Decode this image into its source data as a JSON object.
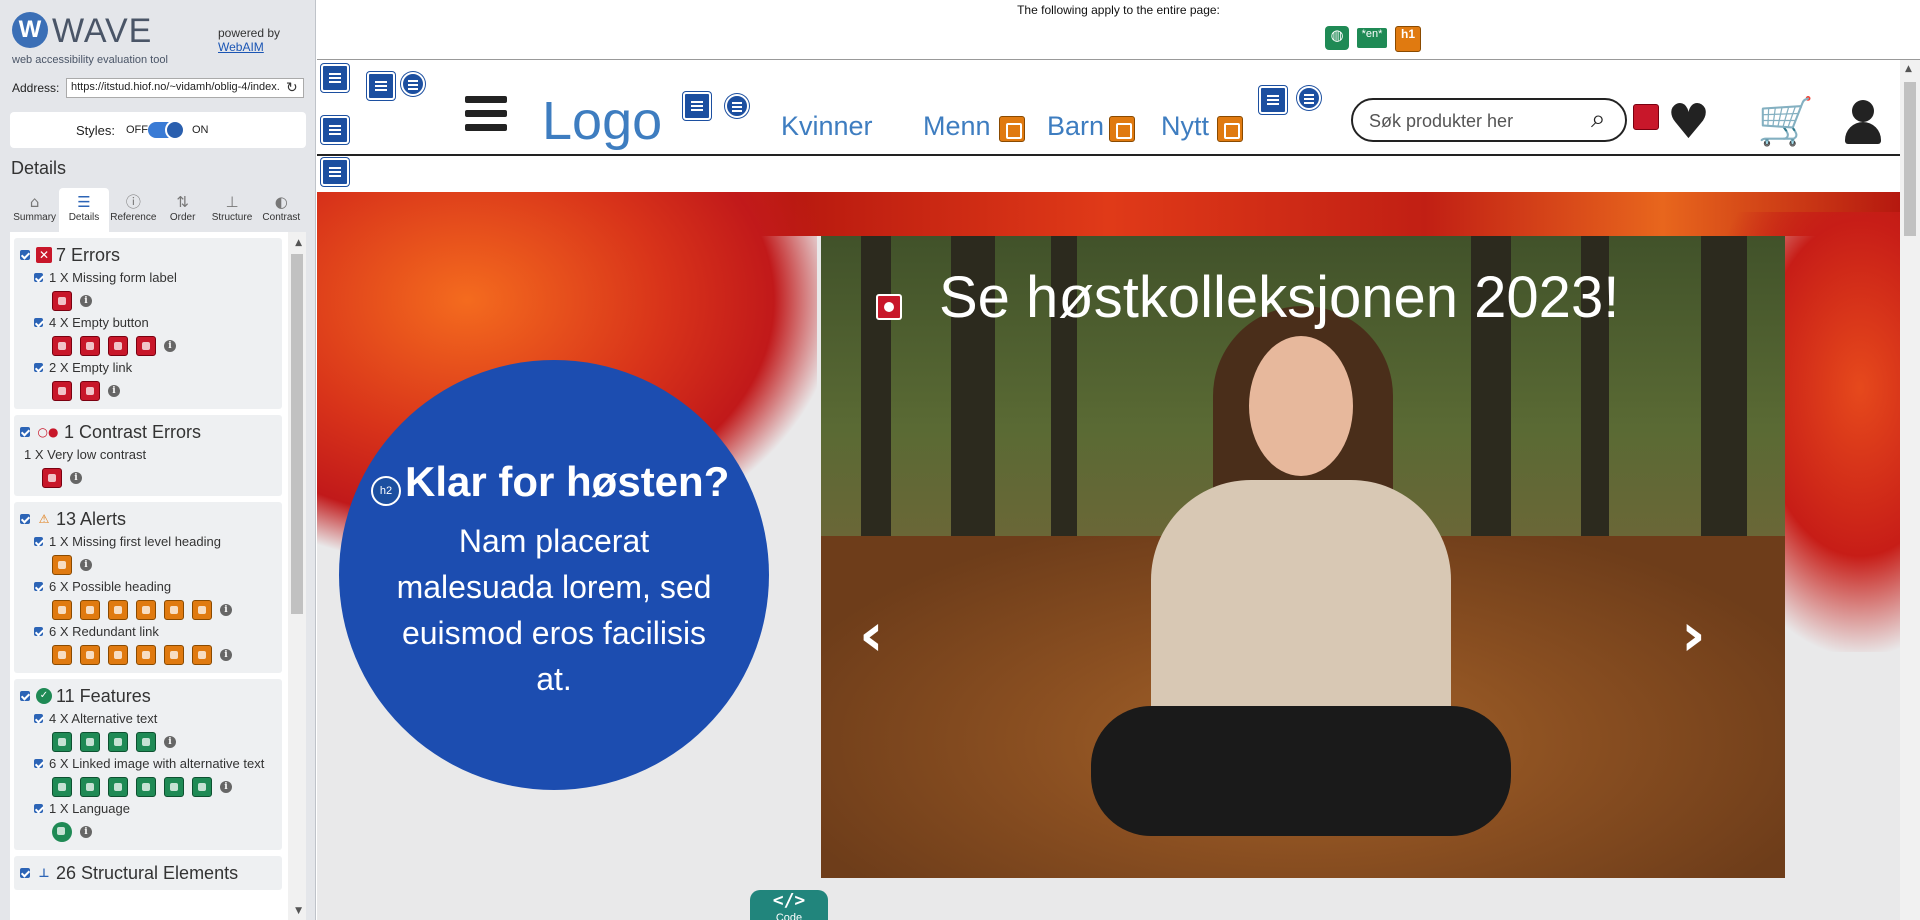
{
  "wave": {
    "brand": "WAVE",
    "tagline": "web accessibility evaluation tool",
    "powered_by": "powered by",
    "webaim_link": "WebAIM",
    "address_label": "Address:",
    "address_value": "https://itstud.hiof.no/~vidamh/oblig-4/index.",
    "styles_label": "Styles:",
    "styles_off": "OFF",
    "styles_on": "ON",
    "details_heading": "Details",
    "tabs": [
      {
        "label": "Summary",
        "icon": "home-icon"
      },
      {
        "label": "Details",
        "icon": "list-icon"
      },
      {
        "label": "Reference",
        "icon": "info-icon"
      },
      {
        "label": "Order",
        "icon": "order-icon"
      },
      {
        "label": "Structure",
        "icon": "structure-icon"
      },
      {
        "label": "Contrast",
        "icon": "contrast-icon"
      }
    ],
    "active_tab": "Details",
    "categories": {
      "errors": {
        "title": "7 Errors",
        "items": [
          {
            "label": "1 X Missing form label",
            "count": 1
          },
          {
            "label": "4 X Empty button",
            "count": 4
          },
          {
            "label": "2 X Empty link",
            "count": 2
          }
        ]
      },
      "contrast": {
        "title": "1 Contrast Errors",
        "items": [
          {
            "label": "1 X Very low contrast",
            "count": 1
          }
        ]
      },
      "alerts": {
        "title": "13 Alerts",
        "items": [
          {
            "label": "1 X Missing first level heading",
            "count": 1
          },
          {
            "label": "6 X Possible heading",
            "count": 6
          },
          {
            "label": "6 X Redundant link",
            "count": 6
          }
        ]
      },
      "features": {
        "title": "11 Features",
        "items": [
          {
            "label": "4 X Alternative text",
            "count": 4
          },
          {
            "label": "6 X Linked image with alternative text",
            "count": 6
          },
          {
            "label": "1 X Language",
            "count": 1
          }
        ]
      },
      "structural": {
        "title": "26 Structural Elements"
      }
    },
    "info_glyph": "i"
  },
  "pagebar": {
    "text": "The following apply to the entire page:",
    "lang_badge": "*en*",
    "h1_badge": "h1"
  },
  "site": {
    "logo": "Logo",
    "nav": [
      "Kvinner",
      "Menn",
      "Barn",
      "Nytt"
    ],
    "search_placeholder": "Søk produkter her",
    "promo_heading": "Klar for høsten?",
    "promo_text": "Nam placerat malesuada lorem, sed euismod eros facilisis at.",
    "h2_badge": "h2",
    "hero_title": "Se høstkolleksjonen 2023!",
    "prev_glyph": "‹",
    "next_glyph": "›"
  },
  "code_tab": {
    "symbol": "</>",
    "label": "Code"
  },
  "colors": {
    "wave_blue": "#2c64b6",
    "error_red": "#c8172a",
    "alert_orange": "#e07a10",
    "feature_green": "#1f8a55",
    "site_blue": "#3e7dc0",
    "promo_blue": "#1c4db0"
  }
}
